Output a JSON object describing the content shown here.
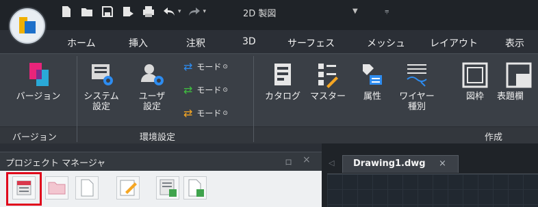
{
  "quick_access": {
    "workspace": "2D 製図",
    "icons": [
      "new-file-icon",
      "open-folder-icon",
      "save-icon",
      "save-as-icon",
      "print-icon",
      "undo-icon",
      "redo-icon"
    ]
  },
  "tabs": [
    "ホーム",
    "挿入",
    "注釈",
    "3D",
    "サーフェス",
    "メッシュ",
    "レイアウト",
    "表示"
  ],
  "ribbon": {
    "version_btn": "バージョン",
    "system_btn": [
      "システム",
      "設定"
    ],
    "user_btn": [
      "ユーザ",
      "設定"
    ],
    "mode_labels": [
      "モード",
      "モード",
      "モード"
    ],
    "catalog_btn": "カタログ",
    "master_btn": "マスター",
    "attribute_btn": "属性",
    "wire_btn": [
      "ワイヤー",
      "種別"
    ],
    "frame_btn": "図枠",
    "titleblock_btn": "表題欄"
  },
  "panels": {
    "version": "バージョン",
    "env": "環境設定",
    "create": "作成"
  },
  "project_manager": {
    "title": "プロジェクト マネージャ",
    "pin": "ロ",
    "close": "×"
  },
  "document": {
    "tab_name": "Drawing1.dwg",
    "close": "×"
  },
  "colors": {
    "accent_blue": "#1d6fc9",
    "accent_yellow": "#f0b000",
    "selection_red": "#e0001a",
    "mode_orange": "#f5a623",
    "mode_green": "#3fbf3f",
    "mode_blue": "#2d8cf0"
  }
}
